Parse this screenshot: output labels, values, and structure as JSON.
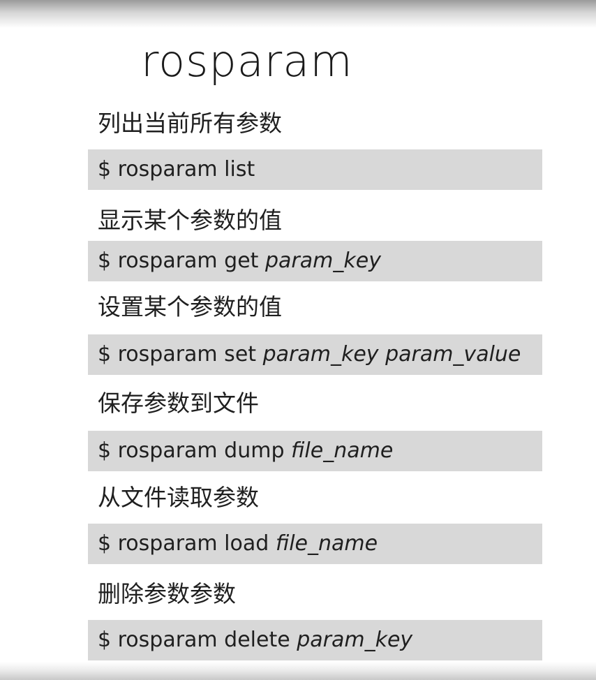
{
  "title": "rosparam",
  "items": [
    {
      "label": "列出当前所有参数",
      "command": "$ rosparam list",
      "args": ""
    },
    {
      "label": "显示某个参数的值",
      "command": "$ rosparam get ",
      "args": "param_key"
    },
    {
      "label": "设置某个参数的值",
      "command": "$ rosparam set ",
      "args": "param_key  param_value"
    },
    {
      "label": "保存参数到文件",
      "command": "$ rosparam  dump  ",
      "args": "file_name"
    },
    {
      "label": "从文件读取参数",
      "command": "$ rosparam  load  ",
      "args": "file_name"
    },
    {
      "label": "删除参数参数",
      "command": "$ rosparam  delete ",
      "args": "param_key"
    }
  ]
}
